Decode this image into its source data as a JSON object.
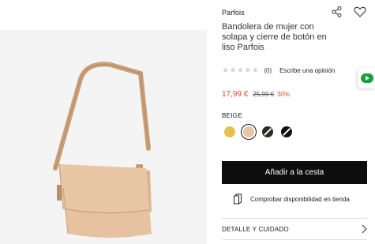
{
  "product": {
    "brand": "Parfois",
    "title": "Bandolera de mujer con solapa y cierre de botón en liso Parfois",
    "rating": {
      "stars": "★★★★★",
      "count": "(0)",
      "write_review": "Escribe una opinión"
    },
    "price": {
      "current": "17,99 €",
      "old": "25,99 €",
      "discount": "30%"
    },
    "color_label": "BEIGE",
    "swatches": [
      {
        "name": "yellow",
        "color": "#e9c04f",
        "selected": false
      },
      {
        "name": "beige",
        "color": "#e8c7a6",
        "selected": true
      },
      {
        "name": "black-brown",
        "color": "#2e2a27",
        "selected": false
      },
      {
        "name": "black",
        "color": "#111111",
        "selected": false
      }
    ]
  },
  "actions": {
    "add_to_cart": "Añadir a la cesta",
    "check_availability": "Comprobar disponibilidad en tienda",
    "details": "DETALLE Y CUIDADO"
  },
  "icons": {
    "share": "share-icon",
    "favorite": "heart-icon",
    "store": "store-icon",
    "chevron": "chevron-right-icon",
    "badge": "green-arrow-badge-icon"
  },
  "colors": {
    "accent_price": "#d64d2a",
    "button_bg": "#0d0d0d",
    "badge_green": "#1a9e3c"
  }
}
